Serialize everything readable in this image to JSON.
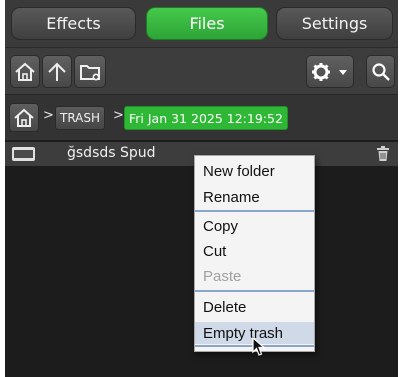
{
  "tabs": [
    {
      "label": "Effects",
      "active": false
    },
    {
      "label": "Files",
      "active": true
    },
    {
      "label": "Settings",
      "active": false
    }
  ],
  "toolbar": {
    "left_icons": [
      "home-icon",
      "up-arrow-icon",
      "new-folder-icon"
    ],
    "right_icons": [
      "gear-icon",
      "dropdown-arrow-icon",
      "search-icon"
    ]
  },
  "breadcrumb": {
    "items": [
      "TRASH",
      "Fri Jan 31 2025 12:19:52"
    ],
    "separator": ">"
  },
  "files": [
    {
      "name": "ğsdsds Spud"
    }
  ],
  "context_menu": {
    "items": [
      "New folder",
      "Rename",
      "Copy",
      "Cut",
      "Paste",
      "Delete",
      "Empty trash"
    ],
    "disabled": [
      "Paste"
    ],
    "hovered": "Empty trash"
  },
  "colors": {
    "accent": "#2eb835",
    "background": "#1d1d1d",
    "menu_bg": "#f4f4f4",
    "separator": "#8aa5cc"
  }
}
